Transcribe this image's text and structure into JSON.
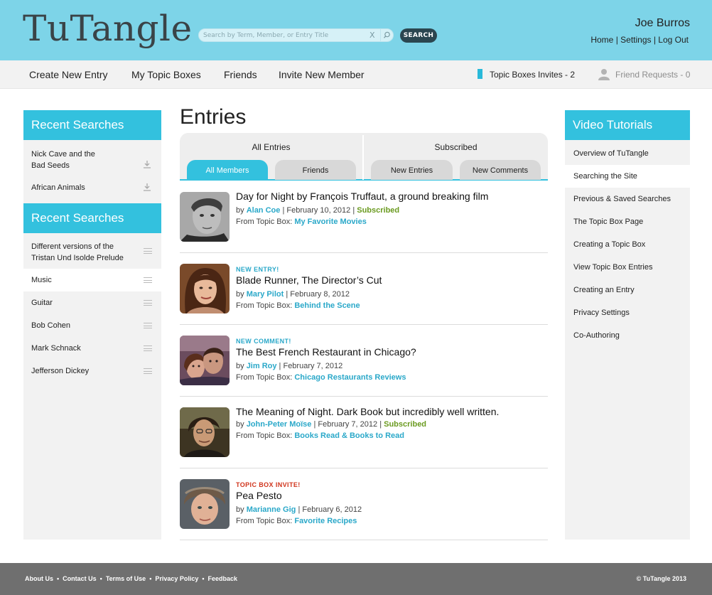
{
  "header": {
    "logo": "TuTangle",
    "search_placeholder": "Search by Term, Member, or Entry Title",
    "search_clear": "X",
    "search_button": "SEARCH",
    "username": "Joe Burros",
    "links": [
      "Home",
      "Settings",
      "Log Out"
    ]
  },
  "nav": {
    "items": [
      "Create New Entry",
      "My Topic Boxes",
      "Friends",
      "Invite New Member"
    ],
    "topic_invites": "Topic Boxes Invites - 2",
    "friend_requests": "Friend Requests - 0"
  },
  "left_sidebar": {
    "section1_title": "Recent Searches",
    "section1_items": [
      {
        "line1": "Nick Cave and the",
        "line2": "Bad Seeds"
      },
      {
        "line1": "African Animals",
        "line2": ""
      }
    ],
    "section2_title": "Recent Searches",
    "section2_items": [
      {
        "line1": "Different versions of the",
        "line2": "Tristan Und Isolde Prelude"
      },
      {
        "line1": "Music",
        "line2": ""
      },
      {
        "line1": "Guitar",
        "line2": ""
      },
      {
        "line1": "Bob Cohen",
        "line2": ""
      },
      {
        "line1": "Mark Schnack",
        "line2": ""
      },
      {
        "line1": "Jefferson Dickey",
        "line2": ""
      }
    ]
  },
  "main": {
    "title": "Entries",
    "tab_groups": [
      "All Entries",
      "Subscribed"
    ],
    "tabs": [
      "All Members",
      "Friends",
      "New Entries",
      "New Comments"
    ],
    "entries": [
      {
        "tag": "",
        "title": "Day for Night by François Truffaut, a ground breaking film",
        "by": "by",
        "author": "Alan Coe",
        "date": "February 10, 2012",
        "status": "Subscribed",
        "from": "From Topic Box:",
        "box": "My Favorite Movies"
      },
      {
        "tag": "NEW ENTRY!",
        "title": "Blade Runner, The Director’s Cut",
        "by": "by",
        "author": "Mary Pilot",
        "date": "February 8, 2012",
        "status": "",
        "from": "From Topic Box:",
        "box": "Behind the Scene"
      },
      {
        "tag": "NEW COMMENT!",
        "title": "The Best French Restaurant in Chicago?",
        "by": "by",
        "author": "Jim Roy",
        "date": "February 7, 2012",
        "status": "",
        "from": "From Topic Box:",
        "box": "Chicago Restaurants Reviews"
      },
      {
        "tag": "",
        "title": "The Meaning of Night. Dark Book but incredibly well written.",
        "by": "by",
        "author": "John-Peter Moïse",
        "date": "February 7, 2012",
        "status": "Subscribed",
        "from": "From Topic Box:",
        "box": "Books Read & Books to Read"
      },
      {
        "tag": "TOPIC BOX INVITE!",
        "title": "Pea Pesto",
        "by": "by",
        "author": "Marianne Gig",
        "date": "February 6, 2012",
        "status": "",
        "from": "From Topic Box:",
        "box": "Favorite Recipes"
      }
    ]
  },
  "right_sidebar": {
    "title": "Video Tutorials",
    "items": [
      "Overview of TuTangle",
      "Searching the Site",
      "Previous & Saved Searches",
      "The Topic Box Page",
      "Creating a Topic Box",
      "View Topic Box Entries",
      "Creating an Entry",
      "Privacy Settings",
      "Co-Authoring"
    ]
  },
  "footer": {
    "links": [
      "About Us",
      "Contact Us",
      "Terms of Use",
      "Privacy Policy",
      "Feedback"
    ],
    "separator": "•",
    "copyright": "© TuTangle 2013"
  },
  "colors": {
    "header_bg": "#7dd4e8",
    "accent": "#33c1de",
    "link": "#2aa8c9",
    "subscribed": "#6a9a1f",
    "new_tag": "#2aa8c9",
    "invite_tag": "#d0341c",
    "footer_bg": "#6f6f6f"
  },
  "icons": {
    "search": "magnifier-icon",
    "download": "download-icon",
    "drag": "drag-handle-icon",
    "topic_box": "topic-box-icon",
    "friend": "person-icon"
  }
}
